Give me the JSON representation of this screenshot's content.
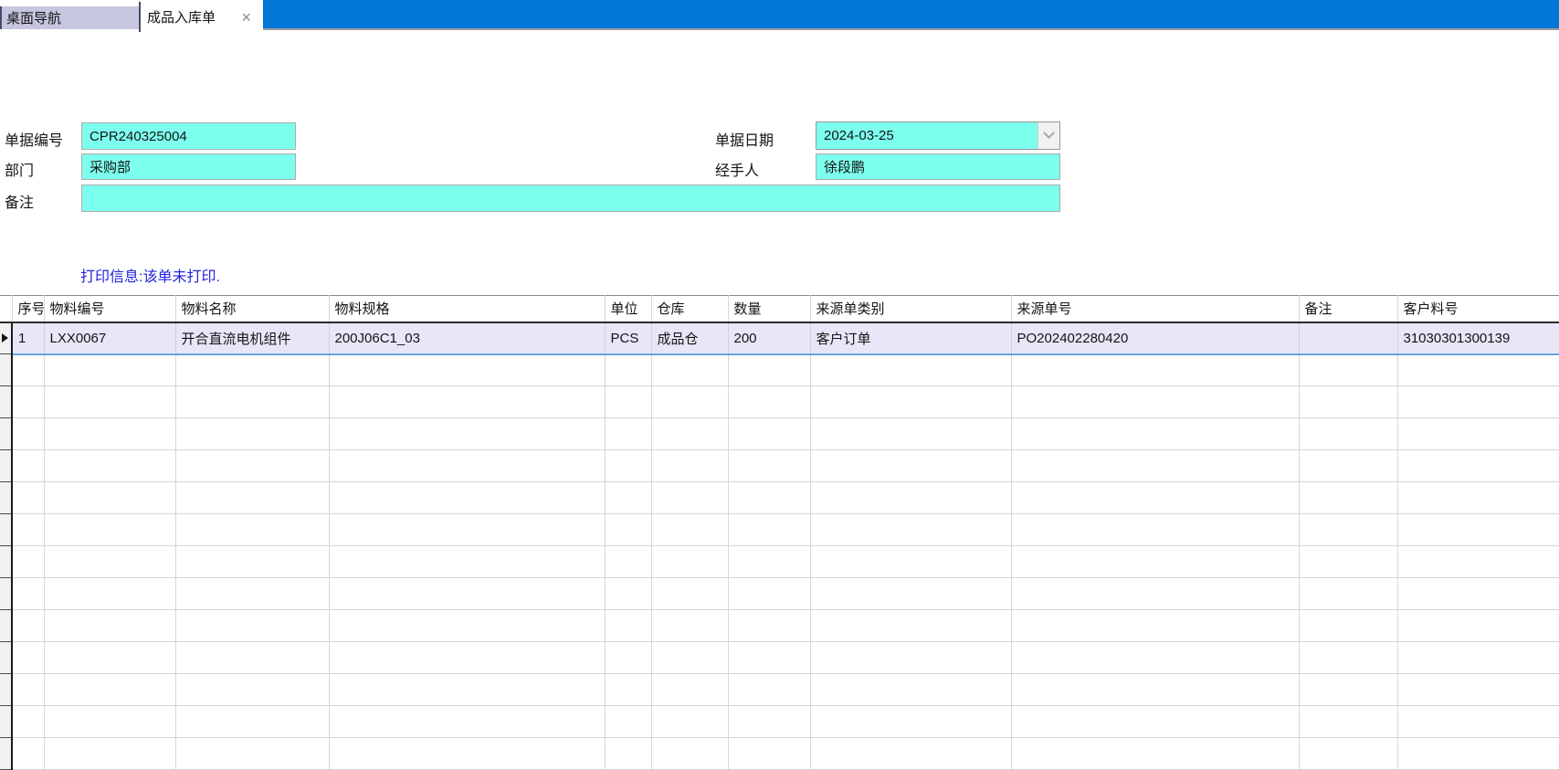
{
  "tabs": [
    {
      "label": "桌面导航",
      "active": false
    },
    {
      "label": "成品入库单",
      "active": true
    }
  ],
  "icons": {
    "tab_close": "×",
    "date_dropdown": "chevron-down",
    "current_row_marker": "right-triangle"
  },
  "form": {
    "doc_no": {
      "label": "单据编号",
      "value": "CPR240325004"
    },
    "doc_date": {
      "label": "单据日期",
      "value": "2024-03-25"
    },
    "department": {
      "label": "部门",
      "value": "采购部"
    },
    "handler": {
      "label": "经手人",
      "value": "徐段鹏"
    },
    "remark": {
      "label": "备注",
      "value": ""
    }
  },
  "print_info": "打印信息:该单未打印.",
  "grid": {
    "columns": [
      "序号",
      "物料编号",
      "物料名称",
      "物料规格",
      "单位",
      "仓库",
      "数量",
      "来源单类别",
      "来源单号",
      "备注",
      "客户料号"
    ],
    "rows": [
      [
        "1",
        "LXX0067",
        "开合直流电机组件",
        "200J06C1_03",
        "PCS",
        "成品仓",
        "200",
        "客户订单",
        "PO202402280420",
        "",
        "31030301300139"
      ]
    ],
    "empty_row_count": 13
  },
  "colors": {
    "tab_bar_blue": "#0078D7",
    "inactive_tab_bg": "#C7C6E1",
    "field_bg": "#7DFFEE",
    "print_info_text": "#2222DD",
    "selected_row_bg": "#E7E7F8",
    "selected_row_border": "#66A3DC",
    "header_border": "#2B2B2B",
    "grid_line": "#D6D6D6"
  }
}
